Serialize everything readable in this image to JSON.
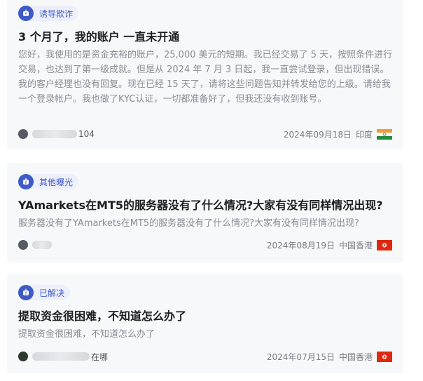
{
  "posts": [
    {
      "tag": "诱导欺诈",
      "title": "3 个月了，我的账户 一直未开通",
      "excerpt": "您好，我使用的是资金充裕的账户，25,000 美元的短期。我已经交易了 5 天，按照条件进行交易，也达到了第一级成就。但是从 2024 年 7 月 3 日起，我一直尝试登录，但出现错误。我的客户经理也没有回复。现在已经 15 天了，请将这些问题告知并转发给您的上级。请给我一个登录帐户。我也做了KYC认证，一切都准备好了，但我还没有收到账号。",
      "username_tail": "104",
      "date": "2024年09月18日",
      "region": "印度",
      "flag": "india-flag"
    },
    {
      "tag": "其他曝光",
      "title": "YAmarkets在MT5的服务器没有了什么情况?大家有没有同样情况出现?",
      "excerpt": "服务器没有了YAmarkets在MT5的服务器没有了什么情况?大家有没有同样情况出现?",
      "username_tail": "",
      "date": "2024年08月19日",
      "region": "中国香港",
      "flag": "hong-kong-flag"
    },
    {
      "tag": "已解决",
      "title": "提取资金很困难，不知道怎么办了",
      "excerpt": "提取资金很困难，不知道怎么办了",
      "username_tail": "在哪",
      "date": "2024年07月15日",
      "region": "中国香港",
      "flag": "hong-kong-flag"
    }
  ],
  "colors": {
    "accent": "#3e59c8",
    "tag_bg": "#edf0fb",
    "card_bg": "#f7f8fa",
    "india_saffron": "#f29a33",
    "india_green": "#1f8f3a",
    "hk_red": "#de2910"
  }
}
